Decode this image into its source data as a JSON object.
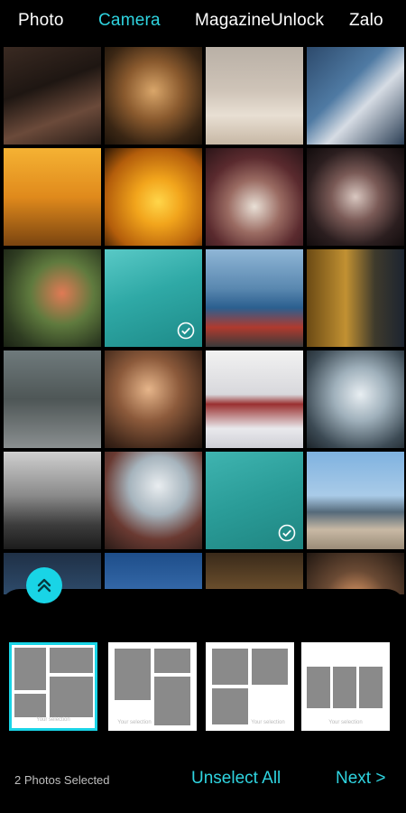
{
  "tabs": [
    {
      "label": "Photo"
    },
    {
      "label": "Camera"
    },
    {
      "label": "MagazineUnlock"
    },
    {
      "label": "Zalo"
    }
  ],
  "active_tab": "Camera",
  "colors": {
    "accent": "#19d4e6",
    "tab_active": "#2fd4e0",
    "background": "#000000"
  },
  "photos": [
    {
      "name": "woman-hat"
    },
    {
      "name": "blonde-woman"
    },
    {
      "name": "woman-white-dress"
    },
    {
      "name": "woman-mirror-door"
    },
    {
      "name": "golden-grass"
    },
    {
      "name": "sunset-silhouette"
    },
    {
      "name": "roses-vase"
    },
    {
      "name": "face-paint-woman"
    },
    {
      "name": "flower-bouquet"
    },
    {
      "name": "bouquet-selected",
      "selected": true
    },
    {
      "name": "woman-boat"
    },
    {
      "name": "woman-shed"
    },
    {
      "name": "black-cat"
    },
    {
      "name": "woman-portrait"
    },
    {
      "name": "woman-bed"
    },
    {
      "name": "woman-splash"
    },
    {
      "name": "man-tractor"
    },
    {
      "name": "woman-lying"
    },
    {
      "name": "still-life-selected",
      "selected": true
    },
    {
      "name": "vintage-car"
    },
    {
      "name": "row6-a"
    },
    {
      "name": "row6-b"
    },
    {
      "name": "row6-c"
    },
    {
      "name": "row6-d"
    }
  ],
  "layouts": [
    {
      "caption": "Your selection",
      "selected": true
    },
    {
      "caption": "Your selection"
    },
    {
      "caption": "Your selection"
    },
    {
      "caption": "Your selection"
    }
  ],
  "footer": {
    "selected_text": "2 Photos Selected",
    "unselect_label": "Unselect All",
    "next_label": "Next >"
  }
}
